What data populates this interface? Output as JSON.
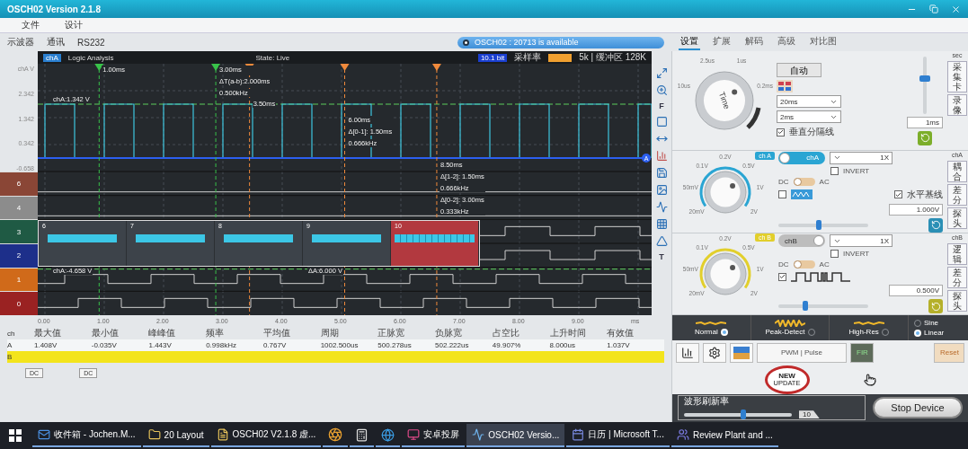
{
  "window": {
    "title": "OSCH02  Version 2.1.8"
  },
  "menu": [
    {
      "label": "文件"
    },
    {
      "label": "设计"
    }
  ],
  "toolbar": [
    {
      "label": "示波器"
    },
    {
      "label": "通讯"
    },
    {
      "label": "RS232"
    }
  ],
  "update_banner": "OSCH02 : 20713 is available",
  "panel_tabs": [
    {
      "label": "设置",
      "selected": true
    },
    {
      "label": "扩展",
      "selected": false
    },
    {
      "label": "解码",
      "selected": false
    },
    {
      "label": "高级",
      "selected": false
    },
    {
      "label": "对比图",
      "selected": false
    }
  ],
  "scope": {
    "header": {
      "channel_tag": "chA",
      "mode": "Logic Analysis",
      "state": "State: Live",
      "bits": "10.1 bit",
      "rate_label": "采样率",
      "buffer": "5k | 缓冲区 128K"
    },
    "y_unit": "chA V",
    "y_labels": [
      "2.342",
      "1.342",
      "0.342",
      "-0.658"
    ],
    "lanes": [
      {
        "label": "6",
        "color": "#8a4636"
      },
      {
        "label": "4",
        "color": "#8c8c8c"
      },
      {
        "label": "3",
        "color": "#1f5a44"
      },
      {
        "label": "2",
        "color": "#1d2f8a"
      },
      {
        "label": "1",
        "color": "#d06a1a"
      },
      {
        "label": "0",
        "color": "#9a2222"
      }
    ],
    "cursors": [
      {
        "kind": "a",
        "labels": [
          "1.00ms"
        ]
      },
      {
        "kind": "a",
        "labels": [
          "3.00ms",
          "ΔT(a-b):2.000ms",
          "0.500kHz"
        ]
      },
      {
        "kind": "b",
        "labels": [
          "3.50ms"
        ]
      },
      {
        "kind": "b",
        "labels": [
          "6.00ms",
          "Δ[0-1]: 1.50ms",
          "0.666kHz"
        ]
      },
      {
        "kind": "b",
        "labels": [
          "8.50ms",
          "Δ[1-2]: 1.50ms",
          "0.666kHz",
          "Δ[0-2]: 3.00ms",
          "0.333kHz"
        ]
      }
    ],
    "readouts": [
      "chA:1.342 V",
      "chA:-4.658 V",
      "ΔA:6.000 V"
    ],
    "baseline_marker": "A",
    "thumbnails": [
      {
        "label": "6",
        "selected": false
      },
      {
        "label": "7",
        "selected": false
      },
      {
        "label": "8",
        "selected": false
      },
      {
        "label": "9",
        "selected": false
      },
      {
        "label": "10",
        "selected": true
      }
    ],
    "x_ticks": [
      "0.00",
      "1.00",
      "2.00",
      "3.00",
      "4.00",
      "5.00",
      "6.00",
      "7.00",
      "8.00",
      "9.00"
    ],
    "x_unit": "ms"
  },
  "tools": [
    {
      "kind": "fit"
    },
    {
      "kind": "zoom"
    },
    {
      "kind": "letter",
      "label": "F"
    },
    {
      "kind": "frame"
    },
    {
      "kind": "span"
    },
    {
      "kind": "bars"
    },
    {
      "kind": "save"
    },
    {
      "kind": "image"
    },
    {
      "kind": "wave"
    },
    {
      "kind": "grid"
    },
    {
      "kind": "ruler"
    },
    {
      "kind": "letter",
      "label": "T"
    }
  ],
  "measurements": {
    "channel_header": "ch",
    "headers": [
      "最大值",
      "最小值",
      "峰峰值",
      "频率",
      "平均值",
      "周期",
      "正脉宽",
      "负脉宽",
      "占空比",
      "上升时间",
      "有效值"
    ],
    "rows": [
      {
        "channel": "A",
        "color": "#f4f6f7",
        "values": [
          "1.408V",
          "-0.035V",
          "1.443V",
          "0.998kHz",
          "0.767V",
          "1002.500us",
          "500.278us",
          "502.222us",
          "49.907%",
          "8.000us",
          "1.037V"
        ]
      },
      {
        "channel": "B",
        "color": "#f3e41c"
      }
    ],
    "coupling": [
      "DC",
      "DC"
    ]
  },
  "timebase": {
    "knob_label": "Time",
    "ticks": [
      "10us",
      "2.5us",
      "1us",
      "0.2ms"
    ],
    "auto_button": "自动",
    "select_main": "20ms",
    "select_sub": "2ms",
    "field": "1ms",
    "unit": "sec",
    "split_line": {
      "label": "垂直分隔线",
      "checked": true
    },
    "slider": {
      "level": 0.6
    },
    "side_tabs": [
      "采集卡",
      "录像"
    ]
  },
  "channels": [
    {
      "name": "chA",
      "badge": "ch A",
      "color": "#2aa5d3",
      "enabled": true,
      "probe": "1X",
      "invert": {
        "label": "INVERT",
        "checked": false
      },
      "coupling": {
        "left": "DC",
        "right": "AC",
        "ac": false
      },
      "ticks": [
        "20mV",
        "50mV",
        "0.1V",
        "0.2V",
        "0.5V",
        "1V",
        "2V"
      ],
      "options": [
        {
          "kind": "wave",
          "checked": false
        },
        {
          "kind": "baseline",
          "label": "水平基线",
          "checked": true
        }
      ],
      "offset": "1.000V",
      "slider": {
        "level": 0.45
      },
      "side_label": "chA",
      "side_tabs": [
        "耦合",
        "差分",
        "探头"
      ]
    },
    {
      "name": "chB",
      "badge": "ch B",
      "color": "#e2cf2c",
      "enabled": false,
      "probe": "1X",
      "invert": {
        "label": "INVERT",
        "checked": false
      },
      "coupling": {
        "left": "DC",
        "right": "AC",
        "ac": false
      },
      "ticks": [
        "20mV",
        "50mV",
        "0.1V",
        "0.2V",
        "0.5V",
        "1V",
        "2V"
      ],
      "options": [
        {
          "kind": "logic",
          "checked": true
        }
      ],
      "offset": "0.500V",
      "slider": {
        "level": 0.3
      },
      "side_label": "chB",
      "side_tabs": [
        "逻辑",
        "差分",
        "探头"
      ]
    }
  ],
  "acquisition": {
    "modes": [
      {
        "label": "Normal",
        "selected": true
      },
      {
        "label": "Peak-Detect",
        "selected": false
      },
      {
        "label": "High-Res",
        "selected": false
      }
    ],
    "interpolation": [
      {
        "label": "Sine",
        "selected": false
      },
      {
        "label": "Linear",
        "selected": true
      }
    ]
  },
  "analysis_buttons": [
    {
      "kind": "histogram"
    },
    {
      "kind": "gear"
    },
    {
      "kind": "spectrum"
    },
    {
      "kind": "text",
      "label": "PWM | Pulse"
    },
    {
      "kind": "filter",
      "label": "FIR"
    },
    {
      "kind": "reset",
      "label": "Reset"
    }
  ],
  "update_badge": {
    "title": "NEW",
    "subtitle": "UPDATE"
  },
  "refresh": {
    "label": "波形刷新率",
    "value": "10",
    "level": 0.55
  },
  "stop_button": "Stop Device",
  "taskbar": [
    {
      "kind": "mail",
      "label": "收件箱 - Jochen.M...",
      "selected": false
    },
    {
      "kind": "folder",
      "label": "20 Layout",
      "selected": false
    },
    {
      "kind": "doc",
      "label": "OSCH02 V2.1.8 虚...",
      "selected": false
    },
    {
      "kind": "browser",
      "selected": false
    },
    {
      "kind": "calculator",
      "selected": false
    },
    {
      "kind": "ie",
      "selected": false
    },
    {
      "kind": "screen",
      "label": "安卓投屏",
      "selected": false
    },
    {
      "kind": "scope",
      "label": "OSCH02  Versio...",
      "selected": true
    },
    {
      "kind": "calendar",
      "label": "日历 | Microsoft T...",
      "selected": false
    },
    {
      "kind": "teams",
      "label": "Review Plant and ...",
      "selected": false
    }
  ]
}
